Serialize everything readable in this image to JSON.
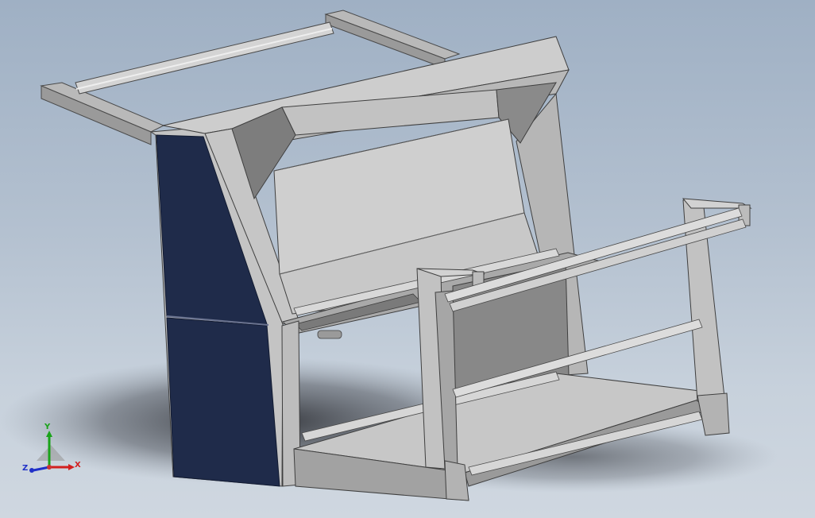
{
  "viewport": {
    "background_top": "#9fb0c4",
    "background_bottom": "#cfd7e0"
  },
  "model": {
    "panel_color": "#1f2b4a",
    "metal_light": "#c9c9c9",
    "metal_mid": "#b3b3b3",
    "metal_dark": "#8f8f8f"
  },
  "triad": {
    "y_label": "Y",
    "x_label": "X",
    "z_label": "Z",
    "y_color": "#1aa31a",
    "x_color": "#d22020",
    "z_color": "#2030c8"
  }
}
